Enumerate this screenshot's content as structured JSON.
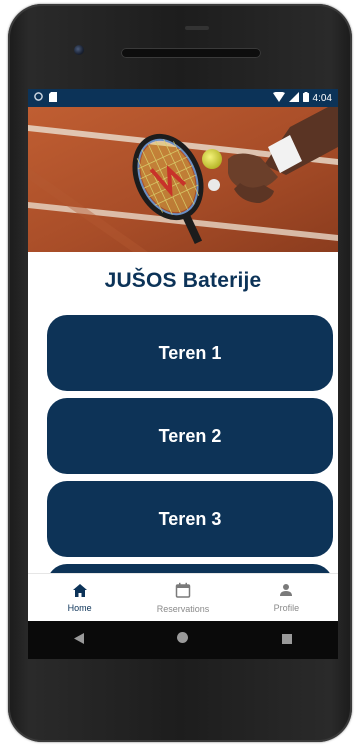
{
  "status_bar": {
    "time": "4:04",
    "left_icons": [
      "circle-status-icon",
      "sd-card-icon"
    ],
    "right_icons": [
      "wifi-icon",
      "signal-icon",
      "battery-icon"
    ]
  },
  "header": {
    "title": "JUŠOS Baterije"
  },
  "courts": [
    {
      "label": "Teren 1"
    },
    {
      "label": "Teren 2"
    },
    {
      "label": "Teren 3"
    },
    {
      "label": ""
    }
  ],
  "bottom_nav": {
    "items": [
      {
        "label": "Home",
        "icon": "home-icon",
        "active": true
      },
      {
        "label": "Reservations",
        "icon": "calendar-icon",
        "active": false
      },
      {
        "label": "Profile",
        "icon": "person-icon",
        "active": false
      }
    ]
  },
  "system_nav": {
    "icons": [
      "back-triangle-icon",
      "home-circle-icon",
      "recents-square-icon"
    ]
  },
  "colors": {
    "primary": "#0c3358",
    "button": "#0d3357",
    "inactive": "#8a8a8a",
    "court_clay": "#b5562e"
  }
}
